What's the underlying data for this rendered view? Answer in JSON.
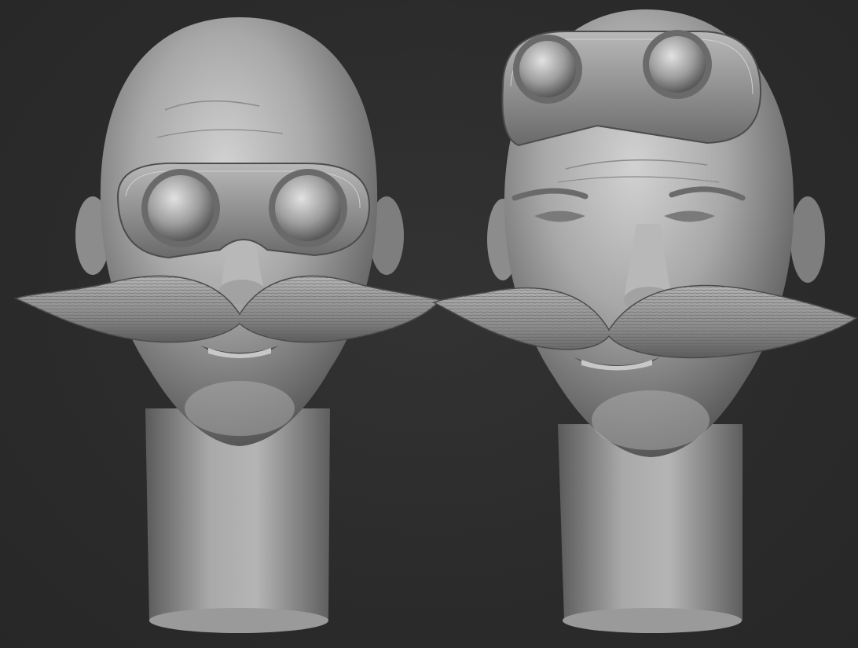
{
  "scene": {
    "background_color": "#2c2c2c",
    "material_color": "#9a9a9a",
    "subjects": [
      {
        "name": "head-goggles-on-eyes",
        "goggles": "over-eyes"
      },
      {
        "name": "head-goggles-on-forehead",
        "goggles": "on-forehead"
      }
    ]
  }
}
